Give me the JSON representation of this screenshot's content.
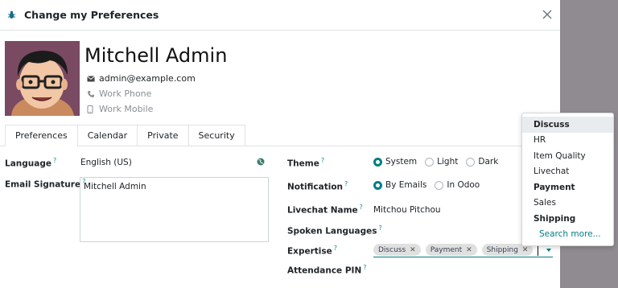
{
  "dialog": {
    "title": "Change my Preferences"
  },
  "profile": {
    "name": "Mitchell Admin",
    "email": "admin@example.com",
    "work_phone_placeholder": "Work Phone",
    "work_mobile_placeholder": "Work Mobile"
  },
  "tabs": [
    {
      "label": "Preferences",
      "active": true
    },
    {
      "label": "Calendar",
      "active": false
    },
    {
      "label": "Private",
      "active": false
    },
    {
      "label": "Security",
      "active": false
    }
  ],
  "left_fields": {
    "language_label": "Language",
    "language_value": "English (US)",
    "signature_label": "Email Signature",
    "signature_value": "Mitchell Admin"
  },
  "right_fields": {
    "theme_label": "Theme",
    "theme_options": [
      "System",
      "Light",
      "Dark"
    ],
    "theme_selected": "System",
    "notification_label": "Notification",
    "notification_options": [
      "By Emails",
      "In Odoo"
    ],
    "notification_selected": "By Emails",
    "livechat_label": "Livechat Name",
    "livechat_value": "Mitchou Pitchou",
    "spoken_label": "Spoken Languages",
    "expertise_label": "Expertise",
    "expertise_tags": [
      "Discuss",
      "Payment",
      "Shipping"
    ],
    "attendance_label": "Attendance PIN"
  },
  "help_marker": "?",
  "dropdown": {
    "items": [
      {
        "label": "Discuss",
        "type": "group",
        "highlighted": true
      },
      {
        "label": "HR",
        "type": "option"
      },
      {
        "label": "Item Quality",
        "type": "option"
      },
      {
        "label": "Livechat",
        "type": "option"
      },
      {
        "label": "Payment",
        "type": "group"
      },
      {
        "label": "Sales",
        "type": "option"
      },
      {
        "label": "Shipping",
        "type": "group"
      },
      {
        "label": "Search more...",
        "type": "more"
      }
    ]
  },
  "colors": {
    "accent": "#017e84",
    "avatar_bg": "#7a4a62"
  },
  "icons": [
    "bug-icon",
    "close-icon",
    "envelope-icon",
    "phone-icon",
    "mobile-icon",
    "globe-icon",
    "tag-remove-icon",
    "caret-down-icon"
  ]
}
